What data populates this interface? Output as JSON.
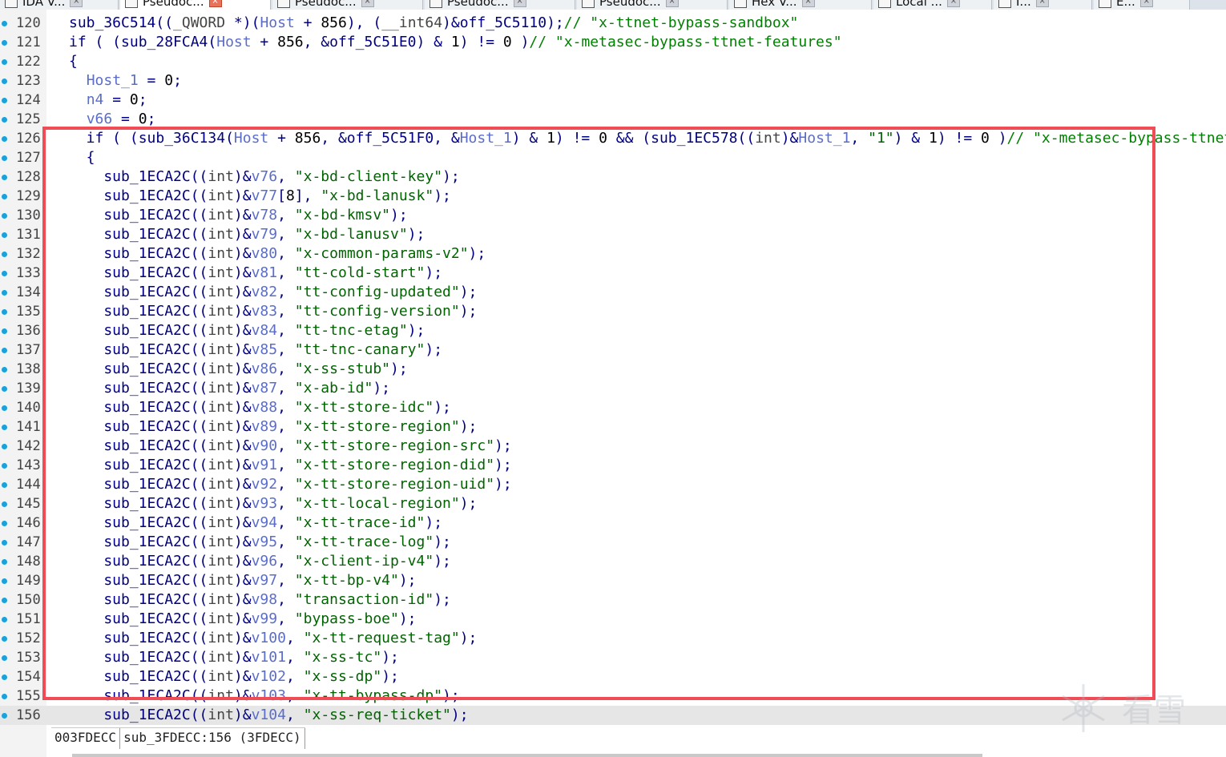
{
  "tabs": [
    {
      "label": "IDA V...",
      "active": false
    },
    {
      "label": "Pseudoc...",
      "active": true
    },
    {
      "label": "Pseudoc...",
      "active": false
    },
    {
      "label": "Pseudoc...",
      "active": false
    },
    {
      "label": "Pseudoc...",
      "active": false
    },
    {
      "label": "Hex V...",
      "active": false
    },
    {
      "label": "Local ...",
      "active": false
    },
    {
      "label": "I...",
      "active": false
    },
    {
      "label": "E...",
      "active": false
    }
  ],
  "code_lines": [
    {
      "ln": "120",
      "text": "sub_36C514((_QWORD *)(Host + 856), (__int64)&off_5C5110);// \"x-ttnet-bypass-sandbox\""
    },
    {
      "ln": "121",
      "text": "if ( (sub_28FCA4(Host + 856, &off_5C51E0) & 1) != 0 )// \"x-metasec-bypass-ttnet-features\""
    },
    {
      "ln": "122",
      "text": "{"
    },
    {
      "ln": "123",
      "text": "  Host_1 = 0;"
    },
    {
      "ln": "124",
      "text": "  n4 = 0;"
    },
    {
      "ln": "125",
      "text": "  v66 = 0;"
    },
    {
      "ln": "126",
      "text": "  if ( (sub_36C134(Host + 856, &off_5C51F0, &Host_1) & 1) != 0 && (sub_1EC578((int)&Host_1, \"1\") & 1) != 0 )// \"x-metasec-bypass-ttnet-"
    },
    {
      "ln": "127",
      "text": "  {"
    },
    {
      "ln": "128",
      "text": "    sub_1ECA2C((int)&v76, \"x-bd-client-key\");"
    },
    {
      "ln": "129",
      "text": "    sub_1ECA2C((int)&v77[8], \"x-bd-lanusk\");"
    },
    {
      "ln": "130",
      "text": "    sub_1ECA2C((int)&v78, \"x-bd-kmsv\");"
    },
    {
      "ln": "131",
      "text": "    sub_1ECA2C((int)&v79, \"x-bd-lanusv\");"
    },
    {
      "ln": "132",
      "text": "    sub_1ECA2C((int)&v80, \"x-common-params-v2\");"
    },
    {
      "ln": "133",
      "text": "    sub_1ECA2C((int)&v81, \"tt-cold-start\");"
    },
    {
      "ln": "134",
      "text": "    sub_1ECA2C((int)&v82, \"tt-config-updated\");"
    },
    {
      "ln": "135",
      "text": "    sub_1ECA2C((int)&v83, \"tt-config-version\");"
    },
    {
      "ln": "136",
      "text": "    sub_1ECA2C((int)&v84, \"tt-tnc-etag\");"
    },
    {
      "ln": "137",
      "text": "    sub_1ECA2C((int)&v85, \"tt-tnc-canary\");"
    },
    {
      "ln": "138",
      "text": "    sub_1ECA2C((int)&v86, \"x-ss-stub\");"
    },
    {
      "ln": "139",
      "text": "    sub_1ECA2C((int)&v87, \"x-ab-id\");"
    },
    {
      "ln": "140",
      "text": "    sub_1ECA2C((int)&v88, \"x-tt-store-idc\");"
    },
    {
      "ln": "141",
      "text": "    sub_1ECA2C((int)&v89, \"x-tt-store-region\");"
    },
    {
      "ln": "142",
      "text": "    sub_1ECA2C((int)&v90, \"x-tt-store-region-src\");"
    },
    {
      "ln": "143",
      "text": "    sub_1ECA2C((int)&v91, \"x-tt-store-region-did\");"
    },
    {
      "ln": "144",
      "text": "    sub_1ECA2C((int)&v92, \"x-tt-store-region-uid\");"
    },
    {
      "ln": "145",
      "text": "    sub_1ECA2C((int)&v93, \"x-tt-local-region\");"
    },
    {
      "ln": "146",
      "text": "    sub_1ECA2C((int)&v94, \"x-tt-trace-id\");"
    },
    {
      "ln": "147",
      "text": "    sub_1ECA2C((int)&v95, \"x-tt-trace-log\");"
    },
    {
      "ln": "148",
      "text": "    sub_1ECA2C((int)&v96, \"x-client-ip-v4\");"
    },
    {
      "ln": "149",
      "text": "    sub_1ECA2C((int)&v97, \"x-tt-bp-v4\");"
    },
    {
      "ln": "150",
      "text": "    sub_1ECA2C((int)&v98, \"transaction-id\");"
    },
    {
      "ln": "151",
      "text": "    sub_1ECA2C((int)&v99, \"bypass-boe\");"
    },
    {
      "ln": "152",
      "text": "    sub_1ECA2C((int)&v100, \"x-tt-request-tag\");"
    },
    {
      "ln": "153",
      "text": "    sub_1ECA2C((int)&v101, \"x-ss-tc\");"
    },
    {
      "ln": "154",
      "text": "    sub_1ECA2C((int)&v102, \"x-ss-dp\");"
    },
    {
      "ln": "155",
      "text": "    sub_1ECA2C((int)&v103, \"x-tt-bypass-dp\");"
    },
    {
      "ln": "156",
      "text": "    sub_1ECA2C((int)&v104, \"x-ss-req-ticket\");"
    }
  ],
  "current_line": "156",
  "status": {
    "address": "003FDECC",
    "location": "sub_3FDECC:156 (3FDECC)"
  },
  "watermark": {
    "text": "看雪"
  },
  "colors": {
    "highlight_box": "#ef4c55",
    "breakpoint_dot": "#1aa2dc",
    "string": "#006400",
    "comment": "#008000",
    "variable": "#5a6dc9",
    "identifier": "#000080"
  }
}
